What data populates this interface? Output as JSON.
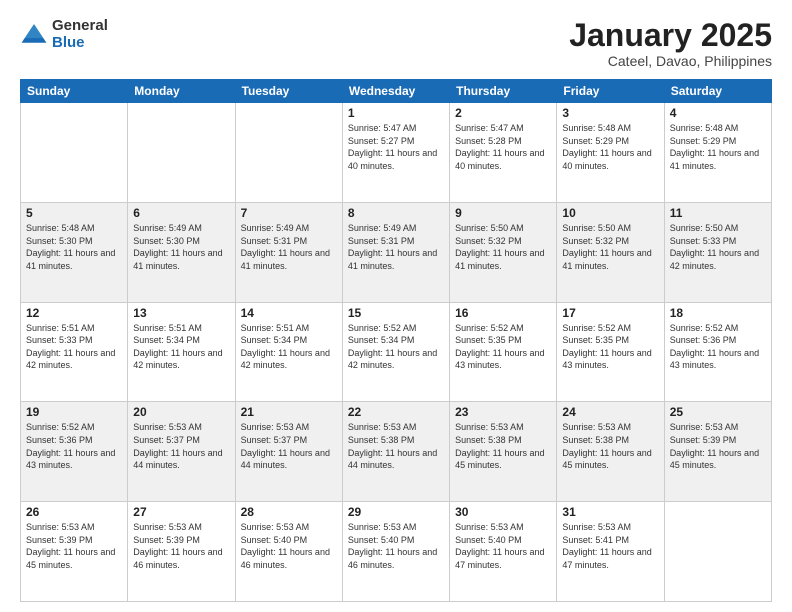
{
  "logo": {
    "general": "General",
    "blue": "Blue"
  },
  "title": "January 2025",
  "subtitle": "Cateel, Davao, Philippines",
  "days_of_week": [
    "Sunday",
    "Monday",
    "Tuesday",
    "Wednesday",
    "Thursday",
    "Friday",
    "Saturday"
  ],
  "weeks": [
    [
      {
        "day": "",
        "sunrise": "",
        "sunset": "",
        "daylight": ""
      },
      {
        "day": "",
        "sunrise": "",
        "sunset": "",
        "daylight": ""
      },
      {
        "day": "",
        "sunrise": "",
        "sunset": "",
        "daylight": ""
      },
      {
        "day": "1",
        "sunrise": "Sunrise: 5:47 AM",
        "sunset": "Sunset: 5:27 PM",
        "daylight": "Daylight: 11 hours and 40 minutes."
      },
      {
        "day": "2",
        "sunrise": "Sunrise: 5:47 AM",
        "sunset": "Sunset: 5:28 PM",
        "daylight": "Daylight: 11 hours and 40 minutes."
      },
      {
        "day": "3",
        "sunrise": "Sunrise: 5:48 AM",
        "sunset": "Sunset: 5:29 PM",
        "daylight": "Daylight: 11 hours and 40 minutes."
      },
      {
        "day": "4",
        "sunrise": "Sunrise: 5:48 AM",
        "sunset": "Sunset: 5:29 PM",
        "daylight": "Daylight: 11 hours and 41 minutes."
      }
    ],
    [
      {
        "day": "5",
        "sunrise": "Sunrise: 5:48 AM",
        "sunset": "Sunset: 5:30 PM",
        "daylight": "Daylight: 11 hours and 41 minutes."
      },
      {
        "day": "6",
        "sunrise": "Sunrise: 5:49 AM",
        "sunset": "Sunset: 5:30 PM",
        "daylight": "Daylight: 11 hours and 41 minutes."
      },
      {
        "day": "7",
        "sunrise": "Sunrise: 5:49 AM",
        "sunset": "Sunset: 5:31 PM",
        "daylight": "Daylight: 11 hours and 41 minutes."
      },
      {
        "day": "8",
        "sunrise": "Sunrise: 5:49 AM",
        "sunset": "Sunset: 5:31 PM",
        "daylight": "Daylight: 11 hours and 41 minutes."
      },
      {
        "day": "9",
        "sunrise": "Sunrise: 5:50 AM",
        "sunset": "Sunset: 5:32 PM",
        "daylight": "Daylight: 11 hours and 41 minutes."
      },
      {
        "day": "10",
        "sunrise": "Sunrise: 5:50 AM",
        "sunset": "Sunset: 5:32 PM",
        "daylight": "Daylight: 11 hours and 41 minutes."
      },
      {
        "day": "11",
        "sunrise": "Sunrise: 5:50 AM",
        "sunset": "Sunset: 5:33 PM",
        "daylight": "Daylight: 11 hours and 42 minutes."
      }
    ],
    [
      {
        "day": "12",
        "sunrise": "Sunrise: 5:51 AM",
        "sunset": "Sunset: 5:33 PM",
        "daylight": "Daylight: 11 hours and 42 minutes."
      },
      {
        "day": "13",
        "sunrise": "Sunrise: 5:51 AM",
        "sunset": "Sunset: 5:34 PM",
        "daylight": "Daylight: 11 hours and 42 minutes."
      },
      {
        "day": "14",
        "sunrise": "Sunrise: 5:51 AM",
        "sunset": "Sunset: 5:34 PM",
        "daylight": "Daylight: 11 hours and 42 minutes."
      },
      {
        "day": "15",
        "sunrise": "Sunrise: 5:52 AM",
        "sunset": "Sunset: 5:34 PM",
        "daylight": "Daylight: 11 hours and 42 minutes."
      },
      {
        "day": "16",
        "sunrise": "Sunrise: 5:52 AM",
        "sunset": "Sunset: 5:35 PM",
        "daylight": "Daylight: 11 hours and 43 minutes."
      },
      {
        "day": "17",
        "sunrise": "Sunrise: 5:52 AM",
        "sunset": "Sunset: 5:35 PM",
        "daylight": "Daylight: 11 hours and 43 minutes."
      },
      {
        "day": "18",
        "sunrise": "Sunrise: 5:52 AM",
        "sunset": "Sunset: 5:36 PM",
        "daylight": "Daylight: 11 hours and 43 minutes."
      }
    ],
    [
      {
        "day": "19",
        "sunrise": "Sunrise: 5:52 AM",
        "sunset": "Sunset: 5:36 PM",
        "daylight": "Daylight: 11 hours and 43 minutes."
      },
      {
        "day": "20",
        "sunrise": "Sunrise: 5:53 AM",
        "sunset": "Sunset: 5:37 PM",
        "daylight": "Daylight: 11 hours and 44 minutes."
      },
      {
        "day": "21",
        "sunrise": "Sunrise: 5:53 AM",
        "sunset": "Sunset: 5:37 PM",
        "daylight": "Daylight: 11 hours and 44 minutes."
      },
      {
        "day": "22",
        "sunrise": "Sunrise: 5:53 AM",
        "sunset": "Sunset: 5:38 PM",
        "daylight": "Daylight: 11 hours and 44 minutes."
      },
      {
        "day": "23",
        "sunrise": "Sunrise: 5:53 AM",
        "sunset": "Sunset: 5:38 PM",
        "daylight": "Daylight: 11 hours and 45 minutes."
      },
      {
        "day": "24",
        "sunrise": "Sunrise: 5:53 AM",
        "sunset": "Sunset: 5:38 PM",
        "daylight": "Daylight: 11 hours and 45 minutes."
      },
      {
        "day": "25",
        "sunrise": "Sunrise: 5:53 AM",
        "sunset": "Sunset: 5:39 PM",
        "daylight": "Daylight: 11 hours and 45 minutes."
      }
    ],
    [
      {
        "day": "26",
        "sunrise": "Sunrise: 5:53 AM",
        "sunset": "Sunset: 5:39 PM",
        "daylight": "Daylight: 11 hours and 45 minutes."
      },
      {
        "day": "27",
        "sunrise": "Sunrise: 5:53 AM",
        "sunset": "Sunset: 5:39 PM",
        "daylight": "Daylight: 11 hours and 46 minutes."
      },
      {
        "day": "28",
        "sunrise": "Sunrise: 5:53 AM",
        "sunset": "Sunset: 5:40 PM",
        "daylight": "Daylight: 11 hours and 46 minutes."
      },
      {
        "day": "29",
        "sunrise": "Sunrise: 5:53 AM",
        "sunset": "Sunset: 5:40 PM",
        "daylight": "Daylight: 11 hours and 46 minutes."
      },
      {
        "day": "30",
        "sunrise": "Sunrise: 5:53 AM",
        "sunset": "Sunset: 5:40 PM",
        "daylight": "Daylight: 11 hours and 47 minutes."
      },
      {
        "day": "31",
        "sunrise": "Sunrise: 5:53 AM",
        "sunset": "Sunset: 5:41 PM",
        "daylight": "Daylight: 11 hours and 47 minutes."
      },
      {
        "day": "",
        "sunrise": "",
        "sunset": "",
        "daylight": ""
      }
    ]
  ]
}
